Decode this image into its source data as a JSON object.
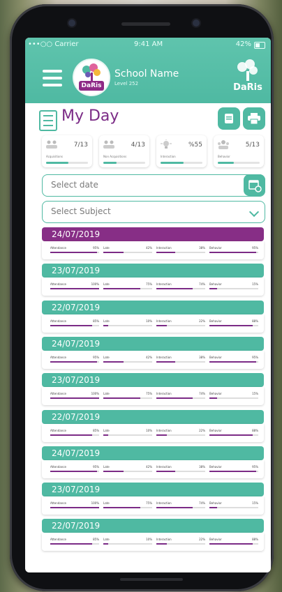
{
  "status": {
    "carrier": "•••○○ Carrier",
    "time": "9:41 AM",
    "battery": "42%"
  },
  "header": {
    "school_name": "School Name",
    "school_level": "Level 252",
    "logo_word": "DaRis",
    "brand_word": "DaRis"
  },
  "title": "My Day",
  "colors": {
    "teal": "#4fb9a2",
    "purple": "#872e86"
  },
  "stats": [
    {
      "icon": "people-icon",
      "value": "7/13",
      "caption": "Acquisitions",
      "progress": 0.54
    },
    {
      "icon": "people-icon",
      "value": "4/13",
      "caption": "Non Acquisitions",
      "progress": 0.31
    },
    {
      "icon": "bulb-icon",
      "value": "%55",
      "caption": "Interaction",
      "progress": 0.55
    },
    {
      "icon": "group-icon",
      "value": "5/13",
      "caption": "Behavior",
      "progress": 0.38
    }
  ],
  "filters": {
    "date_placeholder": "Select date",
    "subject_placeholder": "Select Subject"
  },
  "entries": [
    {
      "date": "24/07/2019",
      "selected": true,
      "metrics": [
        {
          "label": "Attendance",
          "value": "95%",
          "p": 0.95
        },
        {
          "label": "Late",
          "value": "42%",
          "p": 0.42
        },
        {
          "label": "Interaction",
          "value": "38%",
          "p": 0.38
        },
        {
          "label": "Behavior",
          "value": "95%",
          "p": 0.95
        }
      ]
    },
    {
      "date": "23/07/2019",
      "selected": false,
      "metrics": [
        {
          "label": "Attendance",
          "value": "100%",
          "p": 1.0
        },
        {
          "label": "Late",
          "value": "75%",
          "p": 0.75
        },
        {
          "label": "Interaction",
          "value": "74%",
          "p": 0.74
        },
        {
          "label": "Behavior",
          "value": "15%",
          "p": 0.15
        }
      ]
    },
    {
      "date": "22/07/2019",
      "selected": false,
      "metrics": [
        {
          "label": "Attendance",
          "value": "85%",
          "p": 0.85
        },
        {
          "label": "Late",
          "value": "10%",
          "p": 0.1
        },
        {
          "label": "Interaction",
          "value": "22%",
          "p": 0.22
        },
        {
          "label": "Behavior",
          "value": "88%",
          "p": 0.88
        }
      ]
    },
    {
      "date": "24/07/2019",
      "selected": false,
      "metrics": [
        {
          "label": "Attendance",
          "value": "95%",
          "p": 0.95
        },
        {
          "label": "Late",
          "value": "42%",
          "p": 0.42
        },
        {
          "label": "Interaction",
          "value": "38%",
          "p": 0.38
        },
        {
          "label": "Behavior",
          "value": "95%",
          "p": 0.95
        }
      ]
    },
    {
      "date": "23/07/2019",
      "selected": false,
      "metrics": [
        {
          "label": "Attendance",
          "value": "100%",
          "p": 1.0
        },
        {
          "label": "Late",
          "value": "75%",
          "p": 0.75
        },
        {
          "label": "Interaction",
          "value": "74%",
          "p": 0.74
        },
        {
          "label": "Behavior",
          "value": "15%",
          "p": 0.15
        }
      ]
    },
    {
      "date": "22/07/2019",
      "selected": false,
      "metrics": [
        {
          "label": "Attendance",
          "value": "85%",
          "p": 0.85
        },
        {
          "label": "Late",
          "value": "10%",
          "p": 0.1
        },
        {
          "label": "Interaction",
          "value": "22%",
          "p": 0.22
        },
        {
          "label": "Behavior",
          "value": "88%",
          "p": 0.88
        }
      ]
    },
    {
      "date": "24/07/2019",
      "selected": false,
      "metrics": [
        {
          "label": "Attendance",
          "value": "95%",
          "p": 0.95
        },
        {
          "label": "Late",
          "value": "42%",
          "p": 0.42
        },
        {
          "label": "Interaction",
          "value": "38%",
          "p": 0.38
        },
        {
          "label": "Behavior",
          "value": "95%",
          "p": 0.95
        }
      ]
    },
    {
      "date": "23/07/2019",
      "selected": false,
      "metrics": [
        {
          "label": "Attendance",
          "value": "100%",
          "p": 1.0
        },
        {
          "label": "Late",
          "value": "75%",
          "p": 0.75
        },
        {
          "label": "Interaction",
          "value": "74%",
          "p": 0.74
        },
        {
          "label": "Behavior",
          "value": "15%",
          "p": 0.15
        }
      ]
    },
    {
      "date": "22/07/2019",
      "selected": false,
      "metrics": [
        {
          "label": "Attendance",
          "value": "85%",
          "p": 0.85
        },
        {
          "label": "Late",
          "value": "10%",
          "p": 0.1
        },
        {
          "label": "Interaction",
          "value": "22%",
          "p": 0.22
        },
        {
          "label": "Behavior",
          "value": "88%",
          "p": 0.88
        }
      ]
    }
  ]
}
